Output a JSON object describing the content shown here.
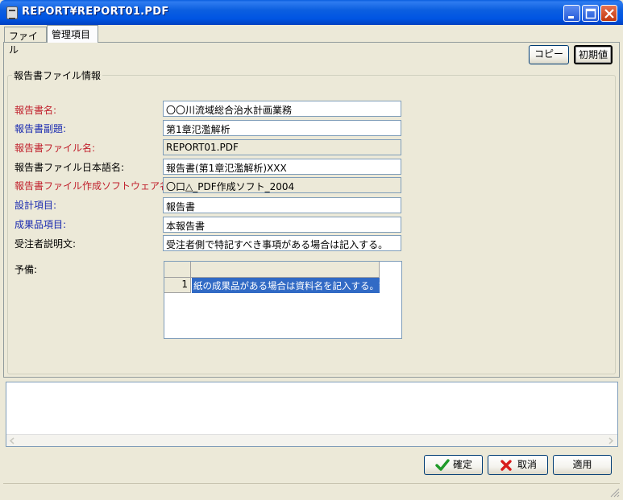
{
  "window": {
    "title": "REPORT¥REPORT01.PDF"
  },
  "tabs": [
    {
      "label": "ファイル",
      "active": false
    },
    {
      "label": "管理項目",
      "active": true
    }
  ],
  "toolbar": {
    "copy_label": "コピー",
    "default_label": "初期値"
  },
  "group": {
    "title": "報告書ファイル情報"
  },
  "fields": [
    {
      "label": "報告書名:",
      "value": "〇〇川流域総合治水計画業務",
      "color": "red",
      "readonly": false
    },
    {
      "label": "報告書副題:",
      "value": "第1章氾濫解析",
      "color": "blue",
      "readonly": false
    },
    {
      "label": "報告書ファイル名:",
      "value": "REPORT01.PDF",
      "color": "red",
      "readonly": true
    },
    {
      "label": "報告書ファイル日本語名:",
      "value": "報告書(第1章氾濫解析)XXX",
      "color": "black",
      "readonly": false
    },
    {
      "label": "報告書ファイル作成ソフトウェア名:",
      "value": "〇口△_PDF作成ソフト_2004",
      "color": "red",
      "readonly": true
    },
    {
      "label": "設計項目:",
      "value": "報告書",
      "color": "blue",
      "readonly": false
    },
    {
      "label": "成果品項目:",
      "value": "本報告書",
      "color": "blue",
      "readonly": false
    },
    {
      "label": "受注者説明文:",
      "value": "受注者側で特記すべき事項がある場合は記入する。",
      "color": "black",
      "readonly": false
    }
  ],
  "reserve": {
    "label": "予備:",
    "rows": [
      {
        "num": "1",
        "text": "紙の成果品がある場合は資料名を記入する。記"
      }
    ]
  },
  "footer": {
    "ok_label": "確定",
    "cancel_label": "取消",
    "apply_label": "適用"
  },
  "colors": {
    "red_label": "#c0202c",
    "blue_label": "#1a2ab0",
    "title_bar": "#0054e3",
    "selection": "#316ac5"
  }
}
